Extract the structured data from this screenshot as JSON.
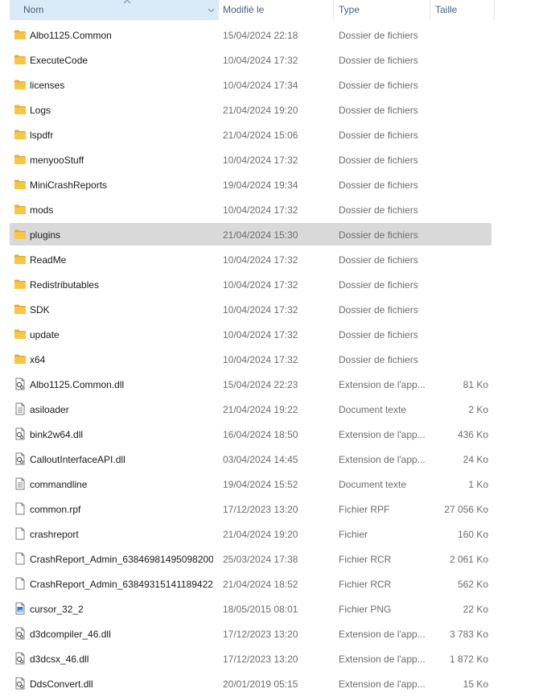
{
  "columns": {
    "name": "Nom",
    "modified": "Modifié le",
    "type": "Type",
    "size": "Taille"
  },
  "items": [
    {
      "name": "Albo1125.Common",
      "date": "15/04/2024 22:18",
      "type": "Dossier de fichiers",
      "size": "",
      "icon": "folder-icon"
    },
    {
      "name": "ExecuteCode",
      "date": "10/04/2024 17:32",
      "type": "Dossier de fichiers",
      "size": "",
      "icon": "folder-icon"
    },
    {
      "name": "licenses",
      "date": "10/04/2024 17:34",
      "type": "Dossier de fichiers",
      "size": "",
      "icon": "folder-icon"
    },
    {
      "name": "Logs",
      "date": "21/04/2024 19:20",
      "type": "Dossier de fichiers",
      "size": "",
      "icon": "folder-icon"
    },
    {
      "name": "lspdfr",
      "date": "21/04/2024 15:06",
      "type": "Dossier de fichiers",
      "size": "",
      "icon": "folder-icon"
    },
    {
      "name": "menyooStuff",
      "date": "10/04/2024 17:32",
      "type": "Dossier de fichiers",
      "size": "",
      "icon": "folder-icon"
    },
    {
      "name": "MiniCrashReports",
      "date": "19/04/2024 19:34",
      "type": "Dossier de fichiers",
      "size": "",
      "icon": "folder-icon"
    },
    {
      "name": "mods",
      "date": "10/04/2024 17:32",
      "type": "Dossier de fichiers",
      "size": "",
      "icon": "folder-icon"
    },
    {
      "name": "plugins",
      "date": "21/04/2024 15:30",
      "type": "Dossier de fichiers",
      "size": "",
      "icon": "folder-icon",
      "selected": true
    },
    {
      "name": "ReadMe",
      "date": "10/04/2024 17:32",
      "type": "Dossier de fichiers",
      "size": "",
      "icon": "folder-icon"
    },
    {
      "name": "Redistributables",
      "date": "10/04/2024 17:32",
      "type": "Dossier de fichiers",
      "size": "",
      "icon": "folder-icon"
    },
    {
      "name": "SDK",
      "date": "10/04/2024 17:32",
      "type": "Dossier de fichiers",
      "size": "",
      "icon": "folder-icon"
    },
    {
      "name": "update",
      "date": "10/04/2024 17:32",
      "type": "Dossier de fichiers",
      "size": "",
      "icon": "folder-icon"
    },
    {
      "name": "x64",
      "date": "10/04/2024 17:32",
      "type": "Dossier de fichiers",
      "size": "",
      "icon": "folder-icon"
    },
    {
      "name": "Albo1125.Common.dll",
      "date": "15/04/2024 22:23",
      "type": "Extension de l'app...",
      "size": "81 Ko",
      "icon": "dll-file-icon"
    },
    {
      "name": "asiloader",
      "date": "21/04/2024 19:22",
      "type": "Document texte",
      "size": "2 Ko",
      "icon": "text-file-icon"
    },
    {
      "name": "bink2w64.dll",
      "date": "16/04/2024 18:50",
      "type": "Extension de l'app...",
      "size": "436 Ko",
      "icon": "dll-file-icon"
    },
    {
      "name": "CalloutInterfaceAPI.dll",
      "date": "03/04/2024 14:45",
      "type": "Extension de l'app...",
      "size": "24 Ko",
      "icon": "dll-file-icon"
    },
    {
      "name": "commandline",
      "date": "19/04/2024 15:52",
      "type": "Document texte",
      "size": "1 Ko",
      "icon": "text-file-icon"
    },
    {
      "name": "common.rpf",
      "date": "17/12/2023 13:20",
      "type": "Fichier RPF",
      "size": "27 056 Ko",
      "icon": "blank-file-icon"
    },
    {
      "name": "crashreport",
      "date": "21/04/2024 19:20",
      "type": "Fichier",
      "size": "160 Ko",
      "icon": "blank-file-icon"
    },
    {
      "name": "CrashReport_Admin_63846981495098200...",
      "date": "25/03/2024 17:38",
      "type": "Fichier RCR",
      "size": "2 061 Ko",
      "icon": "blank-file-icon"
    },
    {
      "name": "CrashReport_Admin_63849315141189422...",
      "date": "21/04/2024 18:52",
      "type": "Fichier RCR",
      "size": "562 Ko",
      "icon": "blank-file-icon"
    },
    {
      "name": "cursor_32_2",
      "date": "18/05/2015 08:01",
      "type": "Fichier PNG",
      "size": "22 Ko",
      "icon": "image-file-icon"
    },
    {
      "name": "d3dcompiler_46.dll",
      "date": "17/12/2023 13:20",
      "type": "Extension de l'app...",
      "size": "3 783 Ko",
      "icon": "dll-file-icon"
    },
    {
      "name": "d3dcsx_46.dll",
      "date": "17/12/2023 13:20",
      "type": "Extension de l'app...",
      "size": "1 872 Ko",
      "icon": "dll-file-icon"
    },
    {
      "name": "DdsConvert.dll",
      "date": "20/01/2019 05:15",
      "type": "Extension de l'app...",
      "size": "15 Ko",
      "icon": "dll-file-icon"
    }
  ],
  "colors": {
    "header_active_bg": "#dbeaf9",
    "selected_row_bg": "#d9d9d9",
    "folder_yellow": "#f8c645",
    "secondary_text": "#6d6d6d"
  }
}
